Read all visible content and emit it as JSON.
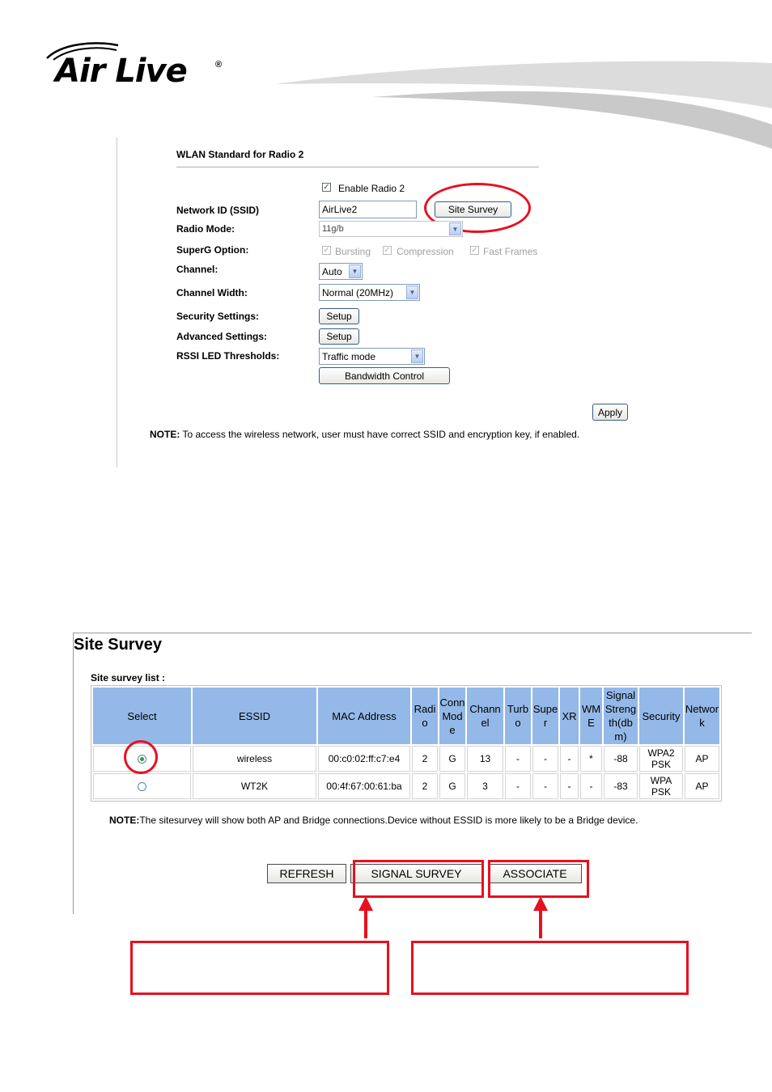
{
  "brand": {
    "name": "Air Live",
    "reg": "®"
  },
  "radio_panel": {
    "title": "WLAN Standard for Radio 2",
    "enable_label": "Enable Radio 2",
    "labels": {
      "ssid": "Network ID (SSID)",
      "radio_mode": "Radio Mode:",
      "superg": "SuperG Option:",
      "channel": "Channel:",
      "channel_width": "Channel Width:",
      "security": "Security Settings:",
      "advanced": "Advanced Settings:",
      "rssi": "RSSI LED Thresholds:"
    },
    "ssid_value": "AirLive2",
    "site_survey_button": "Site Survey",
    "radio_mode_value": "11g/b",
    "superg_options": [
      "Bursting",
      "Compression",
      "Fast Frames"
    ],
    "channel_value": "Auto",
    "channel_width_value": "Normal (20MHz)",
    "setup_label": "Setup",
    "rssi_value": "Traffic mode",
    "bandwidth_button": "Bandwidth Control",
    "apply_button": "Apply",
    "note_bold": "NOTE:",
    "note_text": " To access the wireless network, user must have correct SSID and encryption key, if enabled."
  },
  "survey": {
    "title": "Site Survey",
    "list_label": "Site survey list :",
    "headers": [
      "Select",
      "ESSID",
      "MAC Address",
      "Radi o",
      "Conn Mod e",
      "Chann el",
      "Turb o",
      "Supe r",
      "XR",
      "WM E",
      "Signal Streng th(db m)",
      "Security",
      "Networ k"
    ],
    "rows": [
      {
        "selected": true,
        "essid": "wireless",
        "mac": "00:c0:02:ff:c7:e4",
        "radio": "2",
        "mode": "G",
        "channel": "13",
        "turbo": "-",
        "super": "-",
        "xr": "-",
        "wme": "*",
        "signal": "-88",
        "security": "WPA2 PSK",
        "network": "AP"
      },
      {
        "selected": false,
        "essid": "WT2K",
        "mac": "00:4f:67:00:61:ba",
        "radio": "2",
        "mode": "G",
        "channel": "3",
        "turbo": "-",
        "super": "-",
        "xr": "-",
        "wme": "-",
        "signal": "-83",
        "security": "WPA PSK",
        "network": "AP"
      }
    ],
    "note_bold": "NOTE:",
    "note_text": "The sitesurvey will show both AP and Bridge connections.Device without ESSID is more likely to be a Bridge device.",
    "buttons": {
      "refresh": "REFRESH",
      "signal": "SIGNAL SURVEY",
      "associate": "ASSOCIATE"
    }
  },
  "colors": {
    "annotation_red": "#e8101f",
    "header_blue": "#94b9e8"
  }
}
